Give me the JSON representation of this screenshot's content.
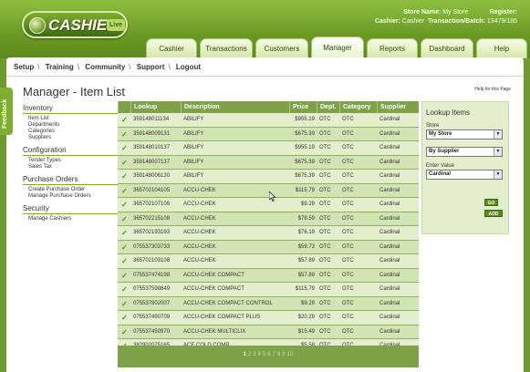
{
  "header": {
    "logo_text": "CASHIER",
    "logo_badge": "Live",
    "store_label": "Store Name:",
    "store_value": "My Store",
    "register_label": "Register:",
    "cashier_label": "Cashier:",
    "cashier_value": "Cashier",
    "txn_label": "Transaction/Batch:",
    "txn_value": "13479/185"
  },
  "tabs": [
    "Cashier",
    "Transactions",
    "Customers",
    "Manager",
    "Reports",
    "Dashboard",
    "Help"
  ],
  "active_tab": "Manager",
  "subnav": [
    "Setup",
    "Training",
    "Community",
    "Support",
    "Logout"
  ],
  "page": {
    "title": "Manager - Item List",
    "help": "Help for this Page",
    "feedback": "Feedback"
  },
  "leftnav": {
    "inventory": {
      "title": "Inventory",
      "items": [
        "Item List",
        "Departments",
        "Categories",
        "Suppliers"
      ]
    },
    "configuration": {
      "title": "Configuration",
      "items": [
        "Tender Types",
        "Sales Tax"
      ]
    },
    "purchase": {
      "title": "Purchase Orders",
      "items": [
        "Create Purchase Order",
        "Manage Purchase Orders"
      ]
    },
    "security": {
      "title": "Security",
      "items": [
        "Manage Cashiers"
      ]
    }
  },
  "table": {
    "headers": [
      "Lookup",
      "Description",
      "Price",
      "Dept.",
      "Category",
      "Supplier"
    ],
    "rows": [
      [
        "359148011134",
        "ABILIFY",
        "$955.19",
        "OTC",
        "OTC",
        "Cardinal"
      ],
      [
        "359148009131",
        "ABILIFY",
        "$675.39",
        "OTC",
        "OTC",
        "Cardinal"
      ],
      [
        "359148010137",
        "ABILIFY",
        "$955.19",
        "OTC",
        "OTC",
        "Cardinal"
      ],
      [
        "359148007137",
        "ABILIFY",
        "$675.39",
        "OTC",
        "OTC",
        "Cardinal"
      ],
      [
        "359148006130",
        "ABILIFY",
        "$675.39",
        "OTC",
        "OTC",
        "Cardinal"
      ],
      [
        "365702104105",
        "ACCU-CHEK",
        "$115.79",
        "OTC",
        "OTC",
        "Cardinal"
      ],
      [
        "365702107106",
        "ACCU-CHEK",
        "$9.29",
        "OTC",
        "OTC",
        "Cardinal"
      ],
      [
        "365702215108",
        "ACCU-CHEK",
        "$78.59",
        "OTC",
        "OTC",
        "Cardinal"
      ],
      [
        "365702193193",
        "ACCU-CHEK",
        "$76.19",
        "OTC",
        "OTC",
        "Cardinal"
      ],
      [
        "075537303733",
        "ACCU-CHEK",
        "$59.73",
        "OTC",
        "OTC",
        "Cardinal"
      ],
      [
        "365702103108",
        "ACCU-CHEK",
        "$57.89",
        "OTC",
        "OTC",
        "Cardinal"
      ],
      [
        "075537474198",
        "ACCU-CHEK COMPACT",
        "$57.89",
        "OTC",
        "OTC",
        "Cardinal"
      ],
      [
        "075537598849",
        "ACCU-CHEK COMPACT",
        "$115.79",
        "OTC",
        "OTC",
        "Cardinal"
      ],
      [
        "075537802007",
        "ACCU-CHEK COMPACT CONTROL",
        "$9.29",
        "OTC",
        "OTC",
        "Cardinal"
      ],
      [
        "075537490709",
        "ACCU-CHEK COMPACT PLUS",
        "$20.29",
        "OTC",
        "OTC",
        "Cardinal"
      ],
      [
        "075537450970",
        "ACCU-CHEK MULTICLIX",
        "$15.49",
        "OTC",
        "OTC",
        "Cardinal"
      ],
      [
        "382902075165",
        "ACE COLD COMP",
        "$5.58",
        "OTC",
        "OTC",
        "Cardinal"
      ]
    ],
    "pages": [
      "1",
      "2",
      "3",
      "4",
      "5",
      "6",
      "7",
      "8",
      "9",
      "10"
    ],
    "current_page": "1"
  },
  "lookup": {
    "title": "Lookup Items",
    "store_label": "Store",
    "store_value": "My Store",
    "by_value": "By Supplier",
    "enter_label": "Enter Value",
    "enter_value": "Cardinal",
    "go_label": "GO",
    "add_label": "ADD"
  },
  "colors": {
    "brand_green": "#7fa248",
    "check": "#4e8a14"
  }
}
